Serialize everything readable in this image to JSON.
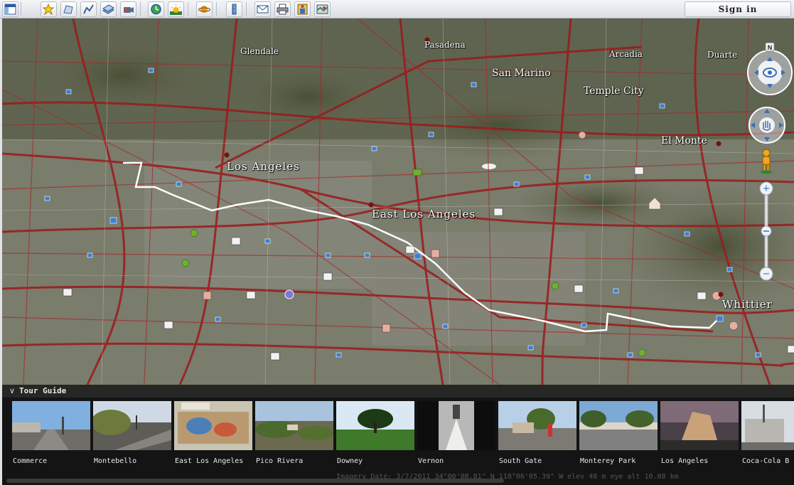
{
  "toolbar": {
    "buttons": [
      {
        "name": "sidebar-toggle-button",
        "icon": "sidebar-icon"
      },
      {
        "name": "add-placemark-button",
        "icon": "placemark-icon"
      },
      {
        "name": "add-polygon-button",
        "icon": "polygon-icon"
      },
      {
        "name": "add-path-button",
        "icon": "path-icon"
      },
      {
        "name": "add-image-overlay-button",
        "icon": "overlay-icon"
      },
      {
        "name": "record-tour-button",
        "icon": "record-icon"
      },
      {
        "name": "historical-imagery-button",
        "icon": "clock-icon"
      },
      {
        "name": "sunlight-button",
        "icon": "sun-icon"
      },
      {
        "name": "switch-planet-button",
        "icon": "planet-icon"
      },
      {
        "name": "ruler-button",
        "icon": "ruler-icon"
      },
      {
        "name": "email-button",
        "icon": "email-icon"
      },
      {
        "name": "print-button",
        "icon": "print-icon"
      },
      {
        "name": "save-image-button",
        "icon": "save-icon"
      },
      {
        "name": "view-in-maps-button",
        "icon": "maps-icon"
      }
    ],
    "sign_in": "Sign in"
  },
  "map": {
    "places": [
      "Glendale",
      "Pasadena",
      "Arcadia",
      "Duarte",
      "San Marino",
      "Temple City",
      "El Monte",
      "Los Angeles",
      "East Los Angeles",
      "Whittier"
    ]
  },
  "navigation": {
    "north_label": "N",
    "zoom_in": "+",
    "zoom_out": "−"
  },
  "tour_guide": {
    "title": "Tour Guide",
    "items": [
      "Commerce",
      "Montebello",
      "East Los Angeles",
      "Pico Rivera",
      "Downey",
      "Vernon",
      "South Gate",
      "Monterey Park",
      "Los Angeles",
      "Coca-Cola B"
    ],
    "status_text": "Imagery Date: 3/7/2011   34°00'08.81\" N 118°06'05.39\" W elev   48 m   eye alt 10.08 km"
  },
  "colors": {
    "roads": "#9a1a1a",
    "route": "#ffffff",
    "terrain": "#6b6e58",
    "tour_background": "#141414"
  }
}
